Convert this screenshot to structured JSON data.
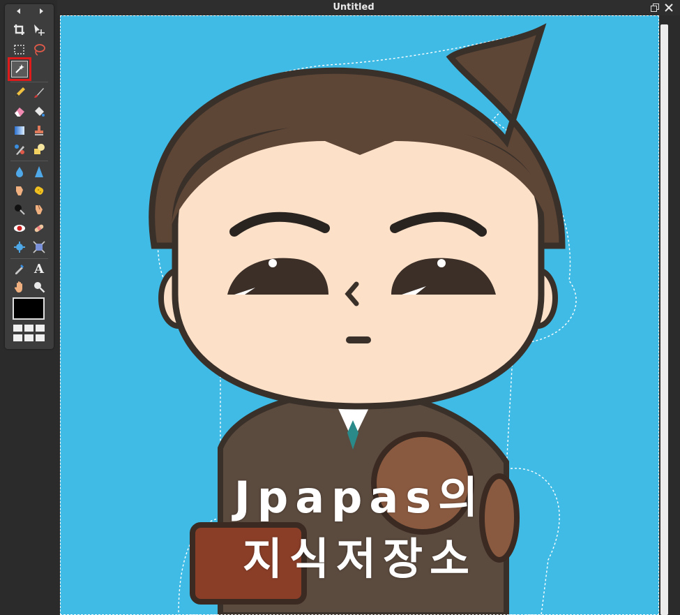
{
  "document": {
    "title": "Untitled"
  },
  "toolbox": {
    "tools": [
      {
        "name": "crop-tool-icon"
      },
      {
        "name": "move-tool-icon"
      },
      {
        "name": "marquee-tool-icon"
      },
      {
        "name": "lasso-tool-icon"
      },
      {
        "name": "magic-wand-tool-icon",
        "selected": true
      },
      {
        "name": "pencil-tool-icon"
      },
      {
        "name": "brush-tool-icon"
      },
      {
        "name": "eraser-tool-icon"
      },
      {
        "name": "paint-bucket-tool-icon"
      },
      {
        "name": "gradient-tool-icon"
      },
      {
        "name": "clone-stamp-tool-icon"
      },
      {
        "name": "color-replace-tool-icon"
      },
      {
        "name": "drawing-shapes-tool-icon"
      },
      {
        "name": "blur-tool-icon"
      },
      {
        "name": "sharpen-tool-icon"
      },
      {
        "name": "smudge-tool-icon"
      },
      {
        "name": "sponge-tool-icon"
      },
      {
        "name": "dodge-tool-icon"
      },
      {
        "name": "burn-tool-icon"
      },
      {
        "name": "red-eye-tool-icon"
      },
      {
        "name": "spot-heal-tool-icon"
      },
      {
        "name": "bloat-tool-icon"
      },
      {
        "name": "pinch-tool-icon"
      },
      {
        "name": "color-picker-tool-icon"
      },
      {
        "name": "type-tool-icon",
        "glyph": "A"
      },
      {
        "name": "hand-tool-icon"
      },
      {
        "name": "zoom-tool-icon"
      }
    ],
    "foreground_color": "#000000"
  },
  "canvas": {
    "background_color": "#3fbbe5",
    "overlay_line1": "Jpapas의",
    "overlay_line2": "지식저장소"
  }
}
